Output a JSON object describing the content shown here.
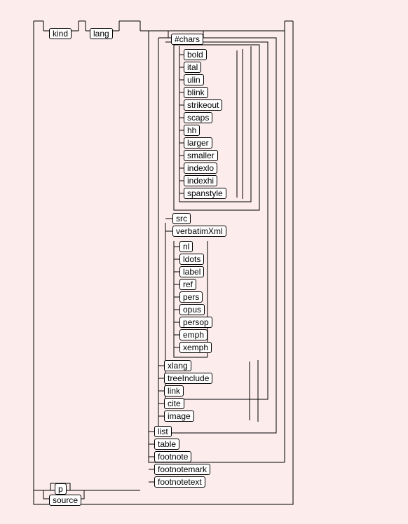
{
  "diagram": {
    "top_nodes": {
      "kind": "kind",
      "lang": "lang",
      "chars": "#chars"
    },
    "group1": {
      "bold": "bold",
      "ital": "ital",
      "ulin": "ulin",
      "blink": "blink",
      "strikeout": "strikeout",
      "scaps": "scaps",
      "hh": "hh",
      "larger": "larger",
      "smaller": "smaller",
      "indexlo": "indexlo",
      "indexhi": "indexhi",
      "spanstyle": "spanstyle"
    },
    "group2": {
      "src": "src",
      "verbatimXml": "verbatimXml"
    },
    "group3": {
      "nl": "nl",
      "ldots": "ldots",
      "label": "label",
      "ref": "ref",
      "pers": "pers",
      "opus": "opus",
      "persop": "persop",
      "emph": "emph",
      "xemph": "xemph"
    },
    "group4": {
      "xlang": "xlang",
      "treeInclude": "treeInclude",
      "link": "link",
      "cite": "cite",
      "image": "image"
    },
    "group5": {
      "list": "list",
      "table": "table",
      "footnote": "footnote",
      "footnotemark": "footnotemark",
      "footnotetext": "footnotetext"
    },
    "bottom": {
      "p": "p",
      "source": "source"
    }
  }
}
